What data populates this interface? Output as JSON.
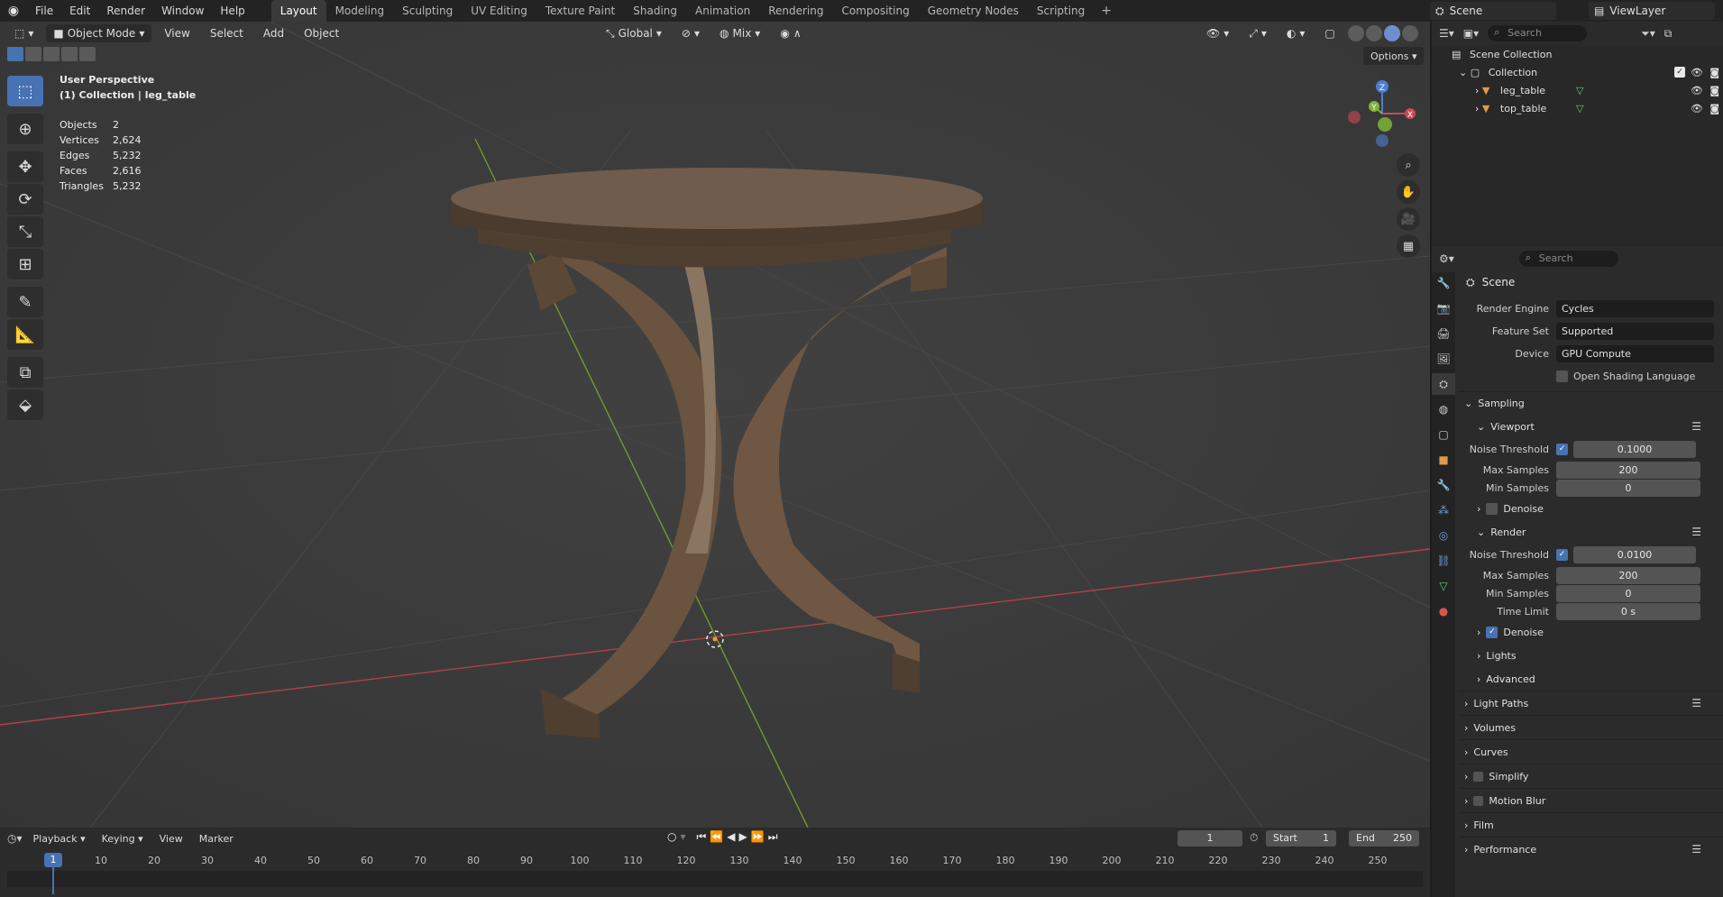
{
  "topbar": {
    "menus": [
      "File",
      "Edit",
      "Render",
      "Window",
      "Help"
    ],
    "workspaces": [
      "Layout",
      "Modeling",
      "Sculpting",
      "UV Editing",
      "Texture Paint",
      "Shading",
      "Animation",
      "Rendering",
      "Compositing",
      "Geometry Nodes",
      "Scripting"
    ],
    "active_workspace": "Layout",
    "scene": "Scene",
    "view_layer": "ViewLayer"
  },
  "viewport": {
    "mode": "Object Mode",
    "menus": [
      "View",
      "Select",
      "Add",
      "Object"
    ],
    "orientation": "Global",
    "pivot": "Mix",
    "options": "Options",
    "perspective": "User Perspective",
    "collection_info": "(1) Collection | leg_table",
    "stats": [
      {
        "k": "Objects",
        "v": "2"
      },
      {
        "k": "Vertices",
        "v": "2,624"
      },
      {
        "k": "Edges",
        "v": "5,232"
      },
      {
        "k": "Faces",
        "v": "2,616"
      },
      {
        "k": "Triangles",
        "v": "5,232"
      }
    ],
    "gizmo": {
      "z": "Z",
      "y": "Y",
      "x": "X"
    }
  },
  "outliner": {
    "search_placeholder": "Search",
    "scene_collection": "Scene Collection",
    "collection": "Collection",
    "objects": [
      "leg_table",
      "top_table"
    ]
  },
  "properties": {
    "search_placeholder": "Search",
    "scene_title": "Scene",
    "render_engine_label": "Render Engine",
    "render_engine": "Cycles",
    "feature_set_label": "Feature Set",
    "feature_set": "Supported",
    "device_label": "Device",
    "device": "GPU Compute",
    "osl_label": "Open Shading Language",
    "sampling": "Sampling",
    "viewport": "Viewport",
    "vp_noise_label": "Noise Threshold",
    "vp_noise": "0.1000",
    "vp_max_label": "Max Samples",
    "vp_max": "200",
    "vp_min_label": "Min Samples",
    "vp_min": "0",
    "denoise": "Denoise",
    "render": "Render",
    "r_noise_label": "Noise Threshold",
    "r_noise": "0.0100",
    "r_max_label": "Max Samples",
    "r_max": "200",
    "r_min_label": "Min Samples",
    "r_min": "0",
    "time_limit_label": "Time Limit",
    "time_limit": "0 s",
    "r_denoise": "Denoise",
    "lights": "Lights",
    "advanced": "Advanced",
    "panels": [
      "Light Paths",
      "Volumes",
      "Curves",
      "Simplify",
      "Motion Blur",
      "Film",
      "Performance"
    ]
  },
  "timeline": {
    "menus": [
      "Playback",
      "Keying",
      "View",
      "Marker"
    ],
    "current_frame": "1",
    "start_label": "Start",
    "start": "1",
    "end_label": "End",
    "end": "250",
    "ticks": [
      "10",
      "20",
      "30",
      "40",
      "50",
      "60",
      "70",
      "80",
      "90",
      "100",
      "110",
      "120",
      "130",
      "140",
      "150",
      "160",
      "170",
      "180",
      "190",
      "200",
      "210",
      "220",
      "230",
      "240",
      "250"
    ]
  }
}
